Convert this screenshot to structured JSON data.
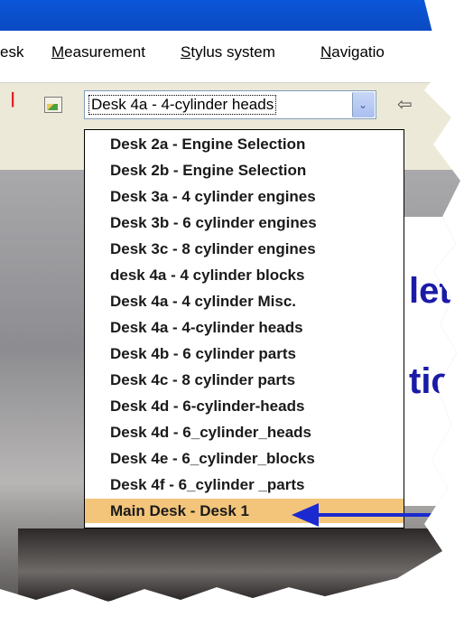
{
  "menu": {
    "items": [
      {
        "label": "esk",
        "underline": false
      },
      {
        "label": "Measurement",
        "underline": "M"
      },
      {
        "label": "Stylus system",
        "underline": "S"
      },
      {
        "label": "Navigatio",
        "underline": "N"
      }
    ]
  },
  "toolbar": {
    "combo_value": "Desk 4a - 4-cylinder heads",
    "combo_button_icon": "chevron-down-icon",
    "back_icon": "back-arrow-icon"
  },
  "dropdown": {
    "items": [
      "Desk 2a - Engine Selection",
      "Desk 2b - Engine Selection",
      "Desk 3a - 4 cylinder engines",
      "Desk 3b - 6 cylinder engines",
      "Desk 3c - 8 cylinder engines",
      "desk 4a - 4 cylinder blocks",
      "Desk 4a - 4 cylinder Misc.",
      "Desk 4a - 4-cylinder heads",
      "Desk 4b - 6 cylinder parts",
      "Desk 4c - 8 cylinder parts",
      "Desk 4d - 6-cylinder-heads",
      "Desk 4d - 6_cylinder_heads",
      "Desk 4e - 6_cylinder_blocks",
      "Desk 4f - 6_cylinder _parts",
      "Main Desk - Desk 1"
    ],
    "highlighted_index": 14
  },
  "background": {
    "partial_texts": [
      "let",
      "tic"
    ]
  },
  "colors": {
    "highlight": "#f3c57a",
    "annotation_arrow": "#1a2ad0",
    "title_bar": "#0b56d9"
  }
}
